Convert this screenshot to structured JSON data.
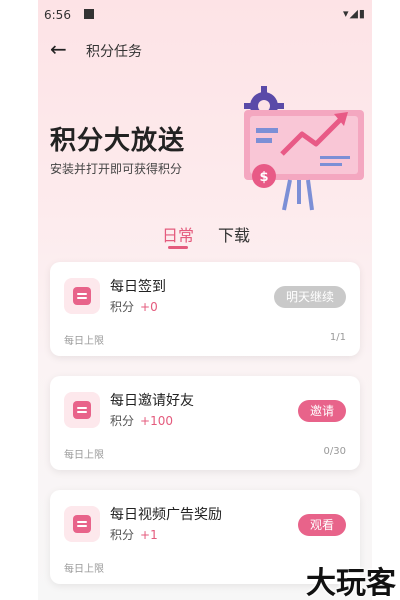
{
  "status": {
    "time": "6:56",
    "icons": "▾◢▮"
  },
  "header": {
    "title": "积分任务"
  },
  "hero": {
    "title": "积分大放送",
    "subtitle": "安装并打开即可获得积分"
  },
  "tabs": [
    {
      "label": "日常",
      "active": true
    },
    {
      "label": "下载",
      "active": false
    }
  ],
  "tasks": [
    {
      "name": "每日签到",
      "points_label": "积分",
      "points": "+0",
      "button": "明天继续",
      "enabled": false,
      "limit_label": "每日上限",
      "progress": "1/1"
    },
    {
      "name": "每日邀请好友",
      "points_label": "积分",
      "points": "+100",
      "button": "邀请",
      "enabled": true,
      "limit_label": "每日上限",
      "progress": "0/30"
    },
    {
      "name": "每日视频广告奖励",
      "points_label": "积分",
      "points": "+1",
      "button": "观看",
      "enabled": true,
      "limit_label": "每日上限",
      "progress": ""
    }
  ],
  "watermark": "大玩客",
  "colors": {
    "accent": "#e45b7d",
    "disabled": "#c9c9c9"
  }
}
